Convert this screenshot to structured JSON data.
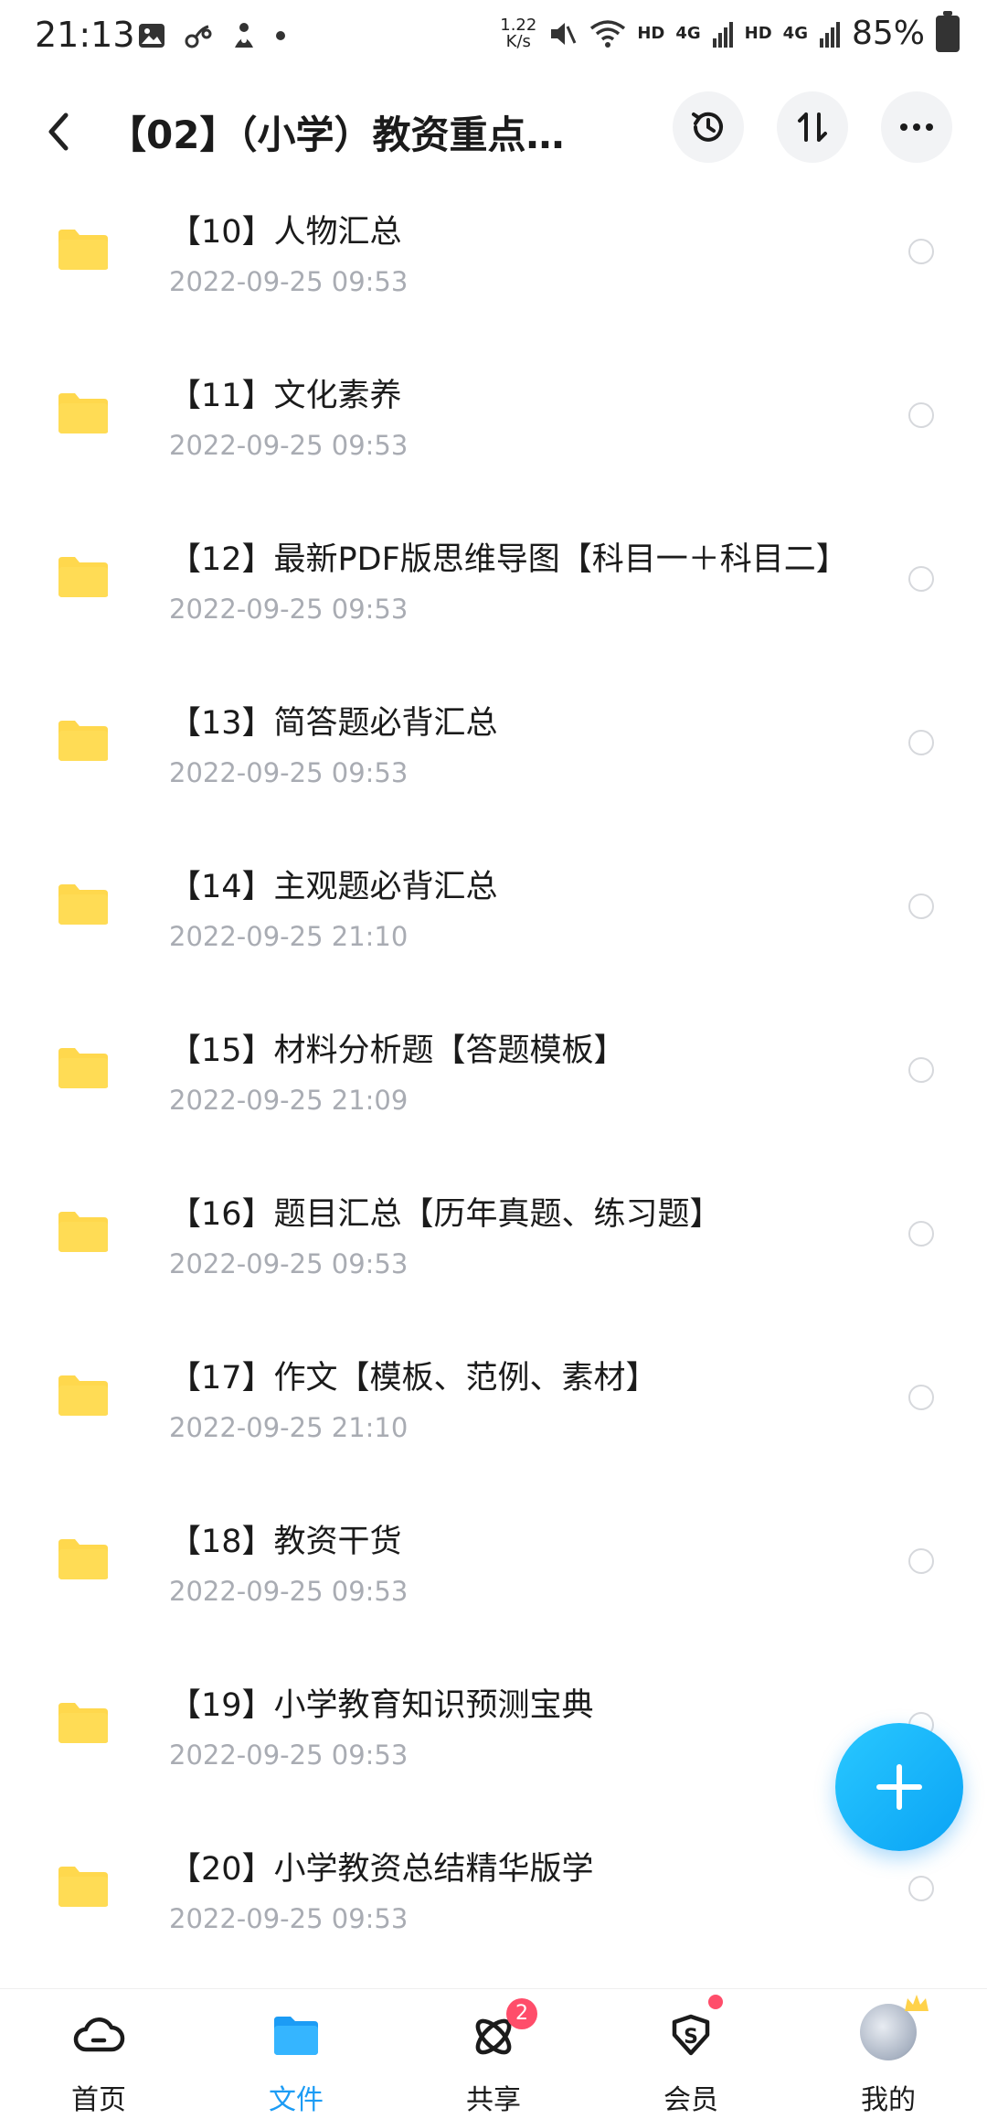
{
  "status_bar": {
    "time": "21:13",
    "speed": "1.22",
    "speed_unit": "K/s",
    "hd1": "HD",
    "net1": "4G",
    "hd2": "HD",
    "net2": "4G",
    "battery": "85%",
    "icons": [
      "gallery-icon",
      "link-icon",
      "app-icon",
      "dot-icon",
      "mute-icon",
      "wifi-icon",
      "signal-icon",
      "battery-icon"
    ]
  },
  "header": {
    "title": "【02】（小学）教资重点资...",
    "actions": [
      "history-icon",
      "sort-icon",
      "more-icon"
    ]
  },
  "files": [
    {
      "name": "【10】人物汇总",
      "date": "2022-09-25  09:53"
    },
    {
      "name": "【11】文化素养",
      "date": "2022-09-25  09:53"
    },
    {
      "name": "【12】最新PDF版思维导图【科目一＋科目二】",
      "date": "2022-09-25  09:53"
    },
    {
      "name": "【13】简答题必背汇总",
      "date": "2022-09-25  09:53"
    },
    {
      "name": "【14】主观题必背汇总",
      "date": "2022-09-25  21:10"
    },
    {
      "name": "【15】材料分析题【答题模板】",
      "date": "2022-09-25  21:09"
    },
    {
      "name": "【16】题目汇总【历年真题、练习题】",
      "date": "2022-09-25  09:53"
    },
    {
      "name": "【17】作文【模板、范例、素材】",
      "date": "2022-09-25  21:10"
    },
    {
      "name": "【18】教资干货",
      "date": "2022-09-25  09:53"
    },
    {
      "name": "【19】小学教育知识预测宝典",
      "date": "2022-09-25  09:53"
    },
    {
      "name": "【20】小学教资总结精华版学",
      "date": "2022-09-25  09:53"
    }
  ],
  "nav": {
    "home": "首页",
    "files": "文件",
    "share": "共享",
    "share_badge": "2",
    "vip": "会员",
    "vip_icon_letter": "S",
    "me": "我的",
    "active": "files"
  },
  "colors": {
    "accent": "#1c9cf5",
    "folder": "#ffd84d",
    "badge": "#ff4d6a",
    "date_gray": "#a9acb3"
  }
}
